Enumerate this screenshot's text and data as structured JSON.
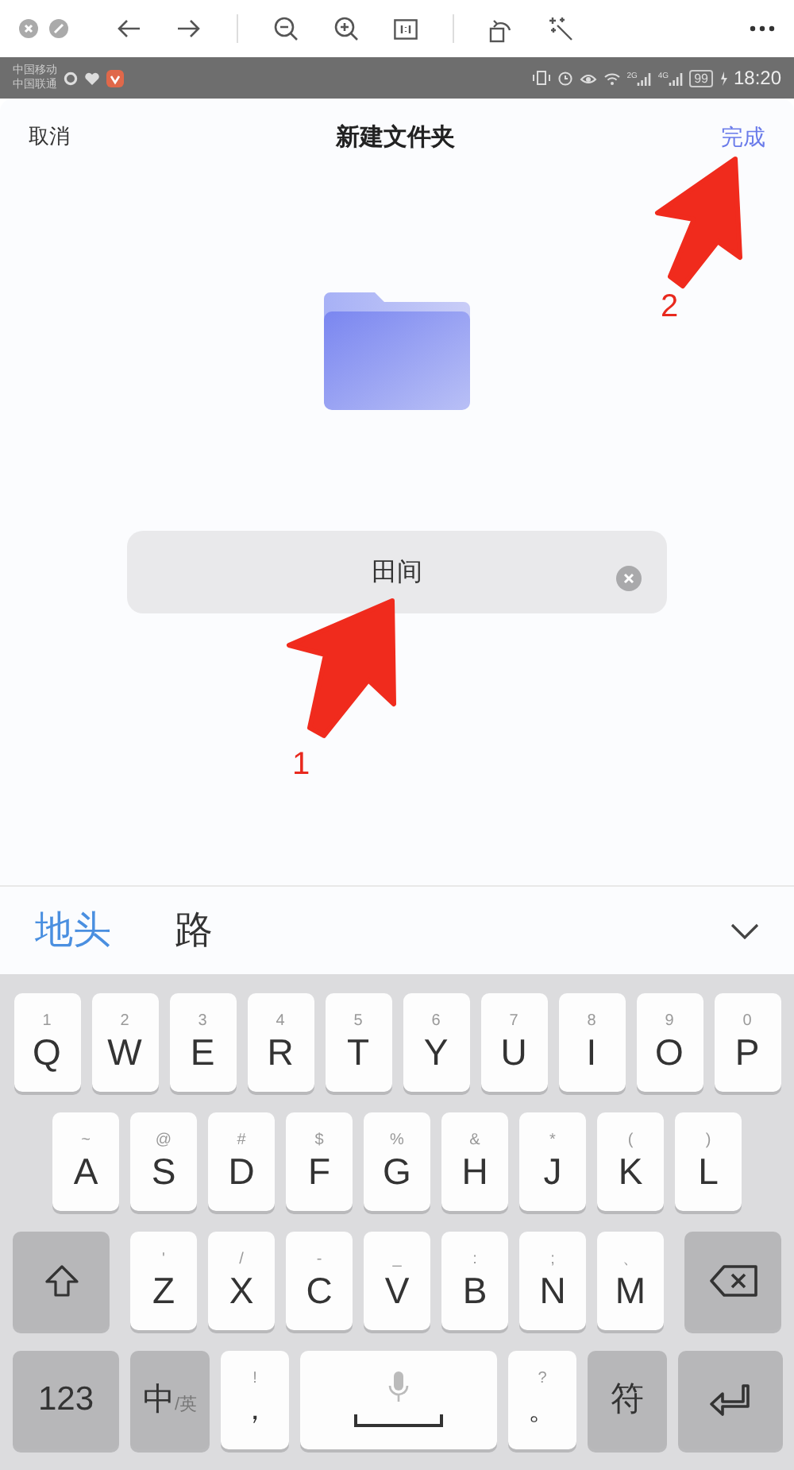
{
  "status_bar": {
    "carriers": [
      "中国移动",
      "中国联通"
    ],
    "network_1": "2G",
    "network_2": "4G",
    "battery": "99",
    "time": "18:20"
  },
  "header": {
    "cancel": "取消",
    "title": "新建文件夹",
    "done": "完成"
  },
  "name_field": {
    "value": "田间"
  },
  "annotations": [
    {
      "label": "1"
    },
    {
      "label": "2"
    }
  ],
  "candidates": [
    {
      "text": "地头",
      "selected": true
    },
    {
      "text": "路",
      "selected": false
    }
  ],
  "keyboard": [
    [
      {
        "kind": "letter",
        "label": "Q",
        "hint": "1"
      },
      {
        "kind": "letter",
        "label": "W",
        "hint": "2"
      },
      {
        "kind": "letter",
        "label": "E",
        "hint": "3"
      },
      {
        "kind": "letter",
        "label": "R",
        "hint": "4"
      },
      {
        "kind": "letter",
        "label": "T",
        "hint": "5"
      },
      {
        "kind": "letter",
        "label": "Y",
        "hint": "6"
      },
      {
        "kind": "letter",
        "label": "U",
        "hint": "7"
      },
      {
        "kind": "letter",
        "label": "I",
        "hint": "8"
      },
      {
        "kind": "letter",
        "label": "O",
        "hint": "9"
      },
      {
        "kind": "letter",
        "label": "P",
        "hint": "0"
      }
    ],
    [
      {
        "kind": "letter",
        "label": "A",
        "hint": "~"
      },
      {
        "kind": "letter",
        "label": "S",
        "hint": "@"
      },
      {
        "kind": "letter",
        "label": "D",
        "hint": "#"
      },
      {
        "kind": "letter",
        "label": "F",
        "hint": "$"
      },
      {
        "kind": "letter",
        "label": "G",
        "hint": "%"
      },
      {
        "kind": "letter",
        "label": "H",
        "hint": "&"
      },
      {
        "kind": "letter",
        "label": "J",
        "hint": "*"
      },
      {
        "kind": "letter",
        "label": "K",
        "hint": "("
      },
      {
        "kind": "letter",
        "label": "L",
        "hint": ")"
      }
    ],
    [
      {
        "kind": "shift"
      },
      {
        "kind": "letter",
        "label": "Z",
        "hint": "'"
      },
      {
        "kind": "letter",
        "label": "X",
        "hint": "/"
      },
      {
        "kind": "letter",
        "label": "C",
        "hint": "-"
      },
      {
        "kind": "letter",
        "label": "V",
        "hint": "_"
      },
      {
        "kind": "letter",
        "label": "B",
        "hint": ":"
      },
      {
        "kind": "letter",
        "label": "N",
        "hint": ";"
      },
      {
        "kind": "letter",
        "label": "M",
        "hint": "、"
      },
      {
        "kind": "backspace"
      }
    ],
    [
      {
        "kind": "function",
        "label": "123"
      },
      {
        "kind": "lang",
        "label": "中",
        "sub": "/英"
      },
      {
        "kind": "punct",
        "label": "，",
        "hint": "!"
      },
      {
        "kind": "space"
      },
      {
        "kind": "punct",
        "label": "。",
        "hint": "?"
      },
      {
        "kind": "function",
        "label": "符"
      },
      {
        "kind": "enter"
      }
    ]
  ]
}
